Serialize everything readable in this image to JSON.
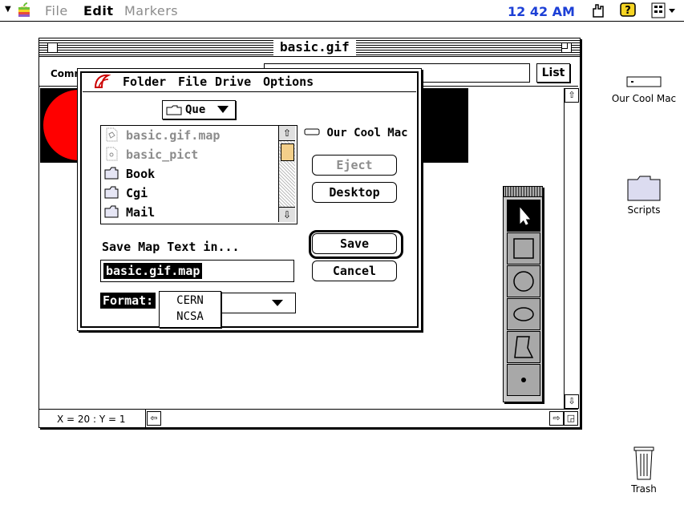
{
  "menubar": {
    "items": [
      "File",
      "Edit",
      "Markers"
    ],
    "clock": "12 42 AM"
  },
  "window": {
    "title": "basic.gif",
    "toolbar_label": "Comm",
    "list_button": "List",
    "coords": "X = 20 : Y = 1"
  },
  "dialog": {
    "menus": [
      "Folder",
      "File",
      "Drive",
      "Options"
    ],
    "folder_popup": "Que",
    "files": [
      {
        "name": "basic.gif.map",
        "dim": true
      },
      {
        "name": "basic_pict",
        "dim": true
      },
      {
        "name": "Book",
        "dim": false
      },
      {
        "name": "Cgi",
        "dim": false
      },
      {
        "name": "Mail",
        "dim": false
      }
    ],
    "volume_name": "Our Cool Mac",
    "eject_button": "Eject",
    "desktop_button": "Desktop",
    "save_button": "Save",
    "cancel_button": "Cancel",
    "save_prompt": "Save Map Text in...",
    "filename": "basic.gif.map",
    "format_label": "Format:",
    "format_options": [
      "CERN",
      "NCSA"
    ]
  },
  "desktop": {
    "icons": [
      {
        "label": "Our Cool Mac",
        "icon": "hard-drive-icon"
      },
      {
        "label": "Scripts",
        "icon": "folder-icon"
      },
      {
        "label": "Trash",
        "icon": "trash-icon"
      }
    ]
  },
  "colors": {
    "clock": "#1c3fd6",
    "image_red": "#ff0000",
    "dim_text": "#8c8c8c"
  }
}
